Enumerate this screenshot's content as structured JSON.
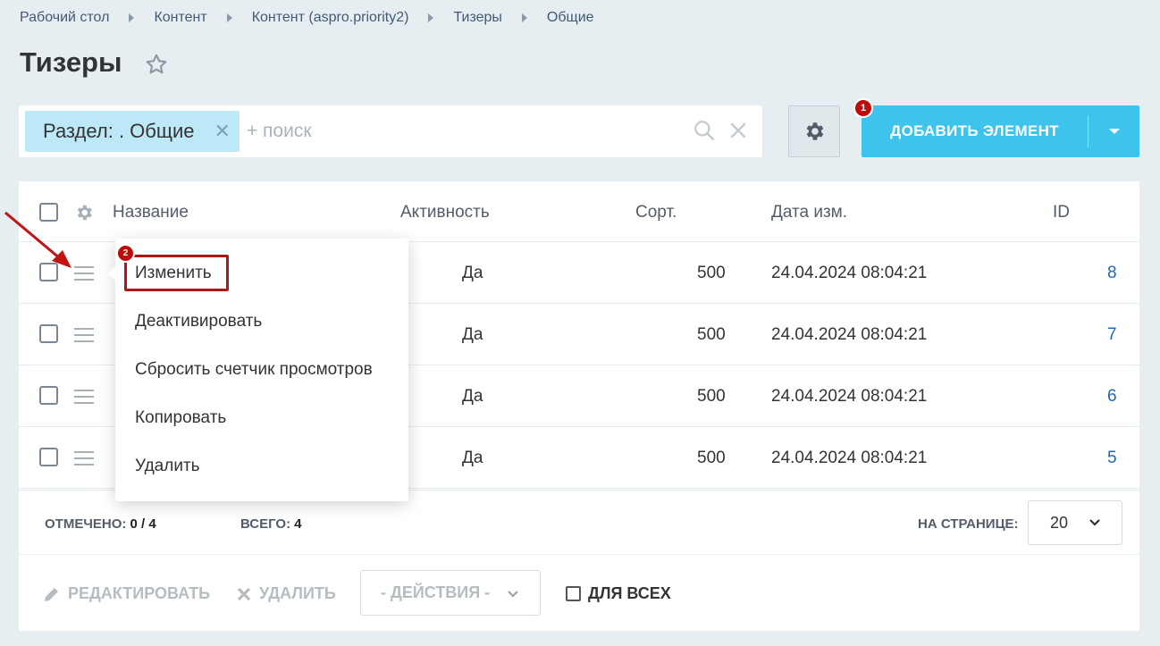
{
  "breadcrumb": [
    "Рабочий стол",
    "Контент",
    "Контент (aspro.priority2)",
    "Тизеры",
    "Общие"
  ],
  "page_title": "Тизеры",
  "filter": {
    "tag": "Раздел: . Общие",
    "placeholder": "+ поиск"
  },
  "add_button": {
    "label": "ДОБАВИТЬ ЭЛЕМЕНТ"
  },
  "badges": {
    "add": "1",
    "edit": "2"
  },
  "table": {
    "headers": {
      "name": "Название",
      "active": "Активность",
      "sort": "Сорт.",
      "date": "Дата изм.",
      "id": "ID"
    },
    "rows": [
      {
        "active": "Да",
        "sort": "500",
        "date": "24.04.2024 08:04:21",
        "id": "8"
      },
      {
        "active": "Да",
        "sort": "500",
        "date": "24.04.2024 08:04:21",
        "id": "7"
      },
      {
        "active": "Да",
        "sort": "500",
        "date": "24.04.2024 08:04:21",
        "id": "6"
      },
      {
        "active": "Да",
        "sort": "500",
        "date": "24.04.2024 08:04:21",
        "id": "5"
      }
    ]
  },
  "context_menu": [
    "Изменить",
    "Деактивировать",
    "Сбросить счетчик просмотров",
    "Копировать",
    "Удалить"
  ],
  "footer": {
    "selected_label": "ОТМЕЧЕНО:",
    "selected_value": "0 / 4",
    "total_label": "ВСЕГО:",
    "total_value": "4",
    "per_page_label": "НА СТРАНИЦЕ:",
    "per_page_value": "20"
  },
  "actions": {
    "edit": "РЕДАКТИРОВАТЬ",
    "delete": "УДАЛИТЬ",
    "select": "- ДЕЙСТВИЯ -",
    "for_all": "ДЛЯ ВСЕХ"
  },
  "colors": {
    "accent": "#3ec3ed",
    "badge": "#c00b0b",
    "link": "#2067b0"
  }
}
